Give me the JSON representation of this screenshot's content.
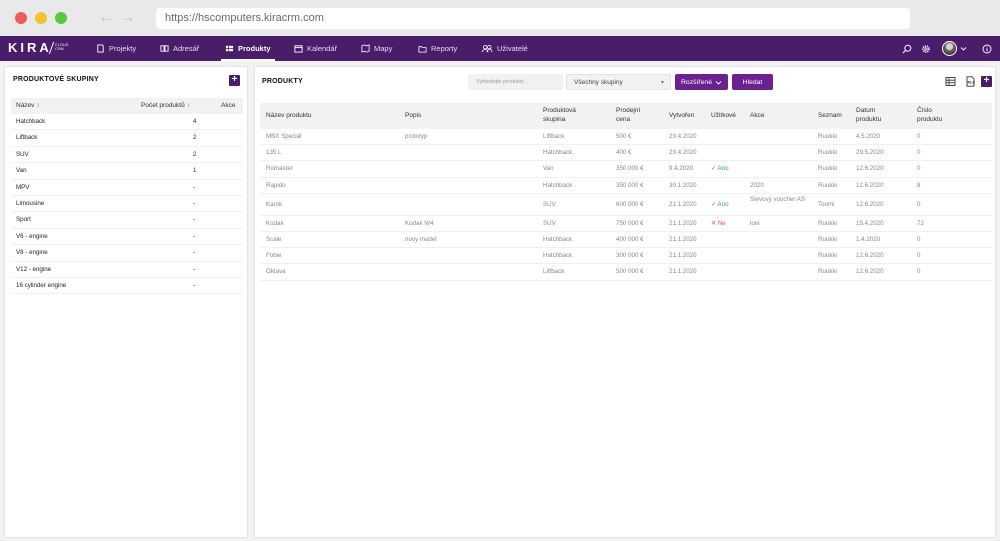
{
  "browser": {
    "url": "https://hscomputers.kiracrm.com"
  },
  "app": {
    "logo": "KIRA",
    "logo_sub_1": "CLOUD",
    "logo_sub_2": "CRM",
    "nav": [
      {
        "label": "Projekty",
        "icon": "projects-icon"
      },
      {
        "label": "Adresář",
        "icon": "address-book-icon"
      },
      {
        "label": "Produkty",
        "icon": "products-icon",
        "active": true
      },
      {
        "label": "Kalendář",
        "icon": "calendar-icon"
      },
      {
        "label": "Mapy",
        "icon": "map-icon"
      },
      {
        "label": "Reporty",
        "icon": "reports-icon"
      },
      {
        "label": "Uživatelé",
        "icon": "users-icon"
      }
    ],
    "accent": "#4a1d6b"
  },
  "groups_panel": {
    "title": "PRODUKTOVÉ SKUPINY",
    "columns": [
      "Název",
      "Počet produktů",
      "Akce"
    ],
    "rows": [
      {
        "name": "Hatchback",
        "count": "4"
      },
      {
        "name": "Liftback",
        "count": "2"
      },
      {
        "name": "SUV",
        "count": "2"
      },
      {
        "name": "Van",
        "count": "1"
      },
      {
        "name": "MPV",
        "count": "-"
      },
      {
        "name": "Limousine",
        "count": "-"
      },
      {
        "name": "Sport",
        "count": "-"
      },
      {
        "name": "V6 - engine",
        "count": "-"
      },
      {
        "name": "V8 - engine",
        "count": "-"
      },
      {
        "name": "V12 - engine",
        "count": "-"
      },
      {
        "name": "16 cylinder engine",
        "count": "-"
      }
    ]
  },
  "products_panel": {
    "title": "PRODUKTY",
    "search_placeholder": "Vyhledejte produkty ...",
    "group_select": "Všechny skupiny",
    "advanced_label": "Rozšířené",
    "search_button": "Hledat",
    "columns": {
      "name": "Název produktu",
      "desc": "Popis",
      "group_1": "Produktová",
      "group_2": "skupina",
      "price_1": "Prodejní",
      "price_2": "cena",
      "created": "Vytvořen",
      "useful": "Užitkové",
      "action": "Akce",
      "list": "Seznam",
      "date_1": "Datum",
      "date_2": "produktu",
      "num_1": "Číslo",
      "num_2": "produktu"
    },
    "rows": [
      {
        "name": "MBX Speciál",
        "desc": "prototyp",
        "group": "Liftback",
        "price": "500 €",
        "created": "29.4.2020",
        "useful": "",
        "action": "",
        "list": "Ruukki",
        "date": "4.5.2020",
        "num": "0"
      },
      {
        "name": "135 L",
        "desc": "",
        "group": "Hatchback",
        "price": "400 €",
        "created": "29.4.2020",
        "useful": "",
        "action": "",
        "list": "Ruukki",
        "date": "29.5.2020",
        "num": "0"
      },
      {
        "name": "Romaster",
        "desc": "",
        "group": "Van",
        "price": "350 000 €",
        "created": "9.4.2020",
        "useful": "✓ Ano",
        "useful_state": "yes",
        "action": "",
        "list": "Ruukki",
        "date": "12.6.2020",
        "num": "0"
      },
      {
        "name": "Rapido",
        "desc": "",
        "group": "Hatchback",
        "price": "350 000 €",
        "created": "30.1.2020",
        "useful": "",
        "action": "2020",
        "list": "Ruukki",
        "date": "12.6.2020",
        "num": "8"
      },
      {
        "name": "Karok",
        "desc": "",
        "group": "SUV",
        "price": "600 000 €",
        "created": "21.1.2020",
        "useful": "✓ Ano",
        "useful_state": "yes",
        "action": "Slevový voucher AS",
        "list": "Toomi",
        "date": "12.6.2020",
        "num": "0",
        "tall": true
      },
      {
        "name": "Kodak",
        "desc": "Kodak W4",
        "group": "SUV",
        "price": "750 000 €",
        "created": "21.1.2020",
        "useful": "✕ Ne",
        "useful_state": "no",
        "action": "loni",
        "list": "Ruukki",
        "date": "15.4.2020",
        "num": "72"
      },
      {
        "name": "Scale",
        "desc": "novy model",
        "group": "Hatchback",
        "price": "400 000 €",
        "created": "21.1.2020",
        "useful": "",
        "action": "",
        "list": "Ruukki",
        "date": "1.4.2020",
        "num": "0"
      },
      {
        "name": "Fobie",
        "desc": "",
        "group": "Hatchback",
        "price": "300 000 €",
        "created": "21.1.2020",
        "useful": "",
        "action": "",
        "list": "Ruukki",
        "date": "12.6.2020",
        "num": "0"
      },
      {
        "name": "Oktava",
        "desc": "",
        "group": "Liftback",
        "price": "500 000 €",
        "created": "21.1.2020",
        "useful": "",
        "action": "",
        "list": "Ruukki",
        "date": "12.6.2020",
        "num": "0"
      }
    ]
  }
}
